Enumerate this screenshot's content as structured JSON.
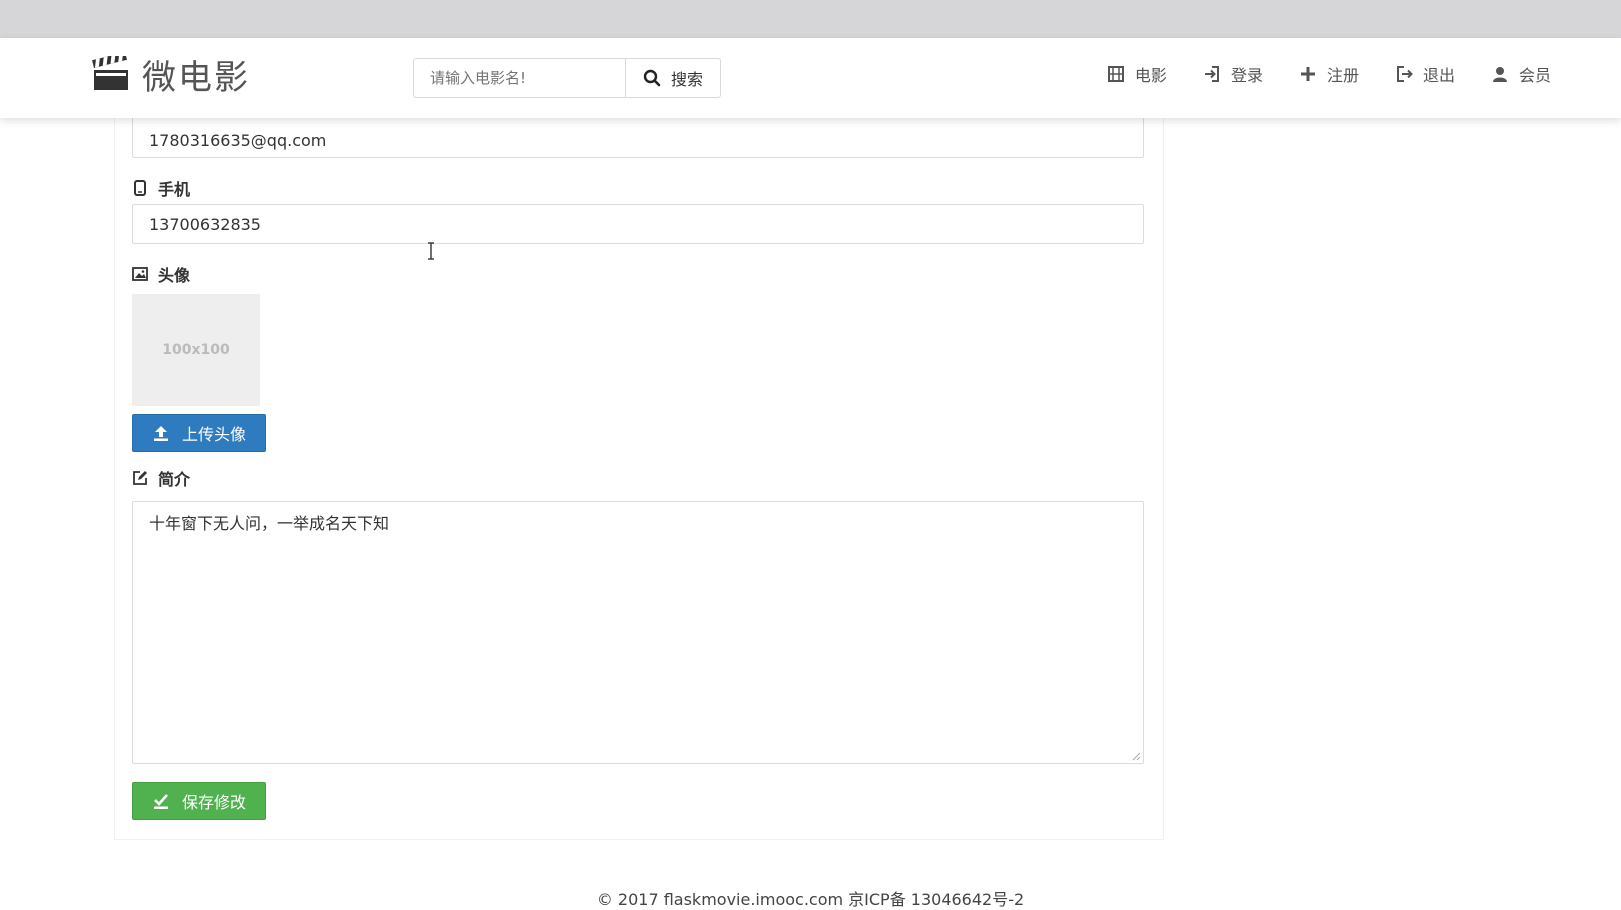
{
  "brand": {
    "name": "微电影"
  },
  "search": {
    "placeholder": "请输入电影名!",
    "button_label": "搜索"
  },
  "nav": {
    "items": [
      {
        "label": "电影",
        "icon": "film-icon"
      },
      {
        "label": "登录",
        "icon": "login-icon"
      },
      {
        "label": "注册",
        "icon": "plus-icon"
      },
      {
        "label": "退出",
        "icon": "logout-icon"
      },
      {
        "label": "会员",
        "icon": "user-icon"
      }
    ]
  },
  "form": {
    "email_value": "1780316635@qq.com",
    "phone_label": "手机",
    "phone_value": "13700632835",
    "avatar_label": "头像",
    "avatar_placeholder": "100x100",
    "upload_button": "上传头像",
    "intro_label": "简介",
    "intro_value": "十年窗下无人问，一举成名天下知",
    "save_button": "保存修改"
  },
  "footer": {
    "text": "© 2017 flaskmovie.imooc.com 京ICP备 13046642号-2"
  },
  "colors": {
    "primary": "#2f7bc0",
    "success": "#4fb24f",
    "topstrip": "#d6d5d8"
  }
}
